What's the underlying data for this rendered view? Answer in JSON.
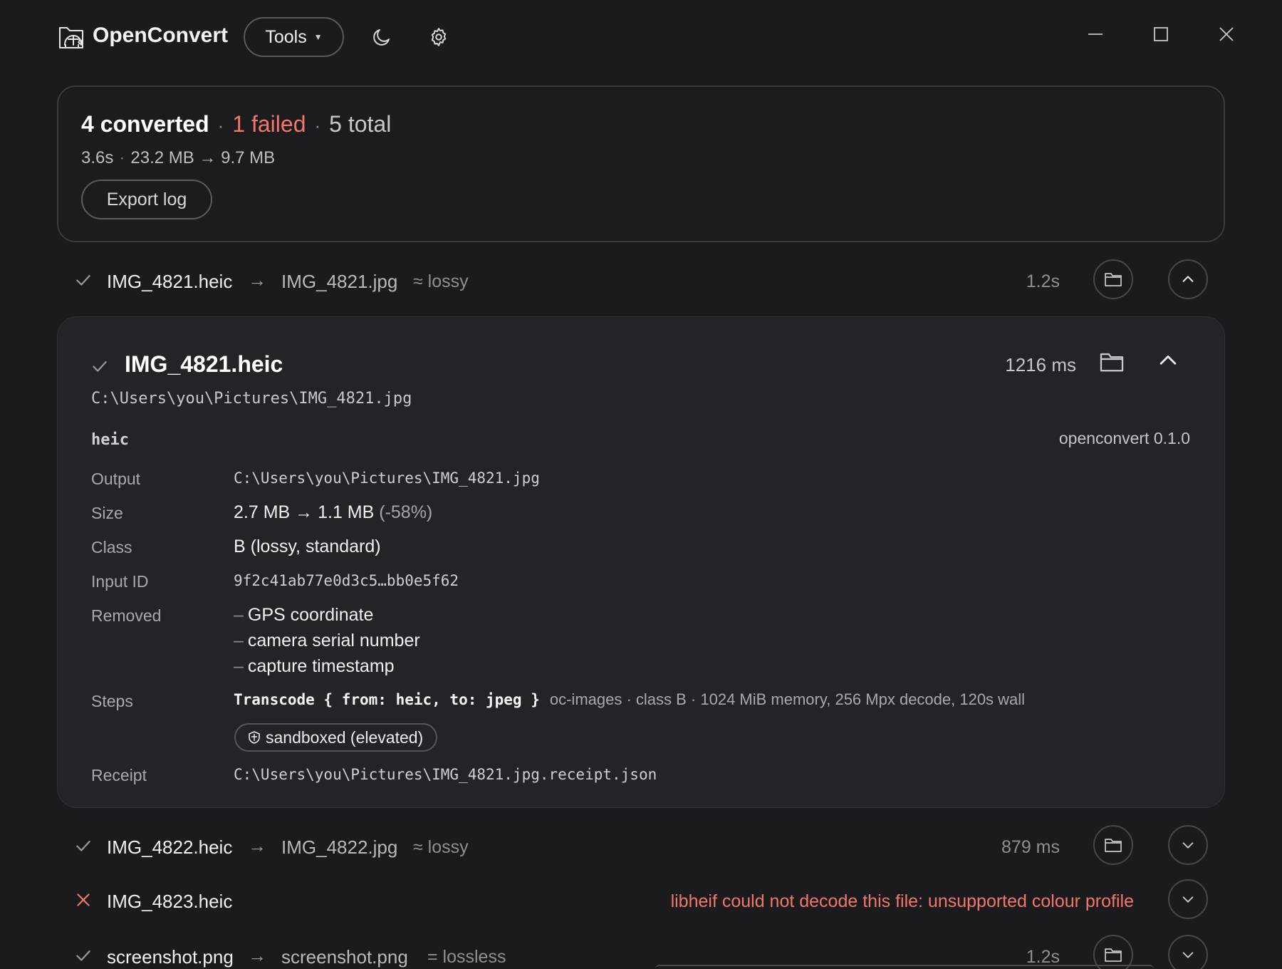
{
  "app": {
    "title": "OpenConvert",
    "tools_label": "Tools"
  },
  "icons": {
    "logo": "turtle-logo-icon",
    "theme": "moon-icon",
    "settings": "gear-icon",
    "minimize": "minimize-icon",
    "maximize": "maximize-icon",
    "close": "close-icon",
    "folder": "folder-icon",
    "check": "check-icon",
    "error": "x-icon",
    "chevron_up": "chevron-up-icon",
    "chevron_down": "chevron-down-icon",
    "shield": "shield-icon"
  },
  "colors": {
    "background": "#1b1b1e",
    "card": "#242428",
    "error": "#f0776a",
    "text": "#f0f0f2",
    "muted": "#8e8e94"
  },
  "summary": {
    "converted": "4 converted",
    "failed": "1 failed",
    "total": "5 total",
    "duration": "3.6s",
    "size": "23.2 MB → 9.7 MB",
    "export_label": "Export log"
  },
  "files": [
    {
      "status": "ok",
      "name": "IMG_4821.heic",
      "arrow": "→",
      "output": "IMG_4821.jpg",
      "quality": "≈ lossy",
      "time": "1.2s",
      "expanded": true
    },
    {
      "status": "ok",
      "name": "IMG_4822.heic",
      "arrow": "→",
      "output": "IMG_4822.jpg",
      "quality": "≈ lossy",
      "time": "879 ms",
      "expanded": false
    },
    {
      "status": "error",
      "name": "IMG_4823.heic",
      "error": "libheif could not decode this file: unsupported colour profile",
      "expanded": false
    },
    {
      "status": "ok",
      "name": "screenshot.png",
      "arrow": "→",
      "output": "screenshot.png",
      "quality": "= lossless",
      "time": "1.2s",
      "expanded": false
    }
  ],
  "detail": {
    "title": "IMG_4821.heic",
    "time": "1216 ms",
    "path": "C:\\Users\\you\\Pictures\\IMG_4821.jpg",
    "format": "heic",
    "version": "openconvert 0.1.0",
    "labels": {
      "output": "Output",
      "size": "Size",
      "class": "Class",
      "input_id": "Input ID",
      "removed": "Removed",
      "steps": "Steps",
      "receipt": "Receipt"
    },
    "output": "C:\\Users\\you\\Pictures\\IMG_4821.jpg",
    "size": "2.7 MB → 1.1 MB",
    "size_change": "(-58%)",
    "class": "B (lossy, standard)",
    "input_id": "9f2c41ab77e0d3c5…bb0e5f62",
    "removed": [
      "GPS coordinate",
      "camera serial number",
      "capture timestamp"
    ],
    "step_code": "Transcode { from: heic, to: jpeg }",
    "step_meta": "oc-images · class B · 1024 MiB memory, 256 Mpx decode, 120s wall",
    "sandbox": "sandboxed (elevated)",
    "receipt": "C:\\Users\\you\\Pictures\\IMG_4821.jpg.receipt.json"
  }
}
